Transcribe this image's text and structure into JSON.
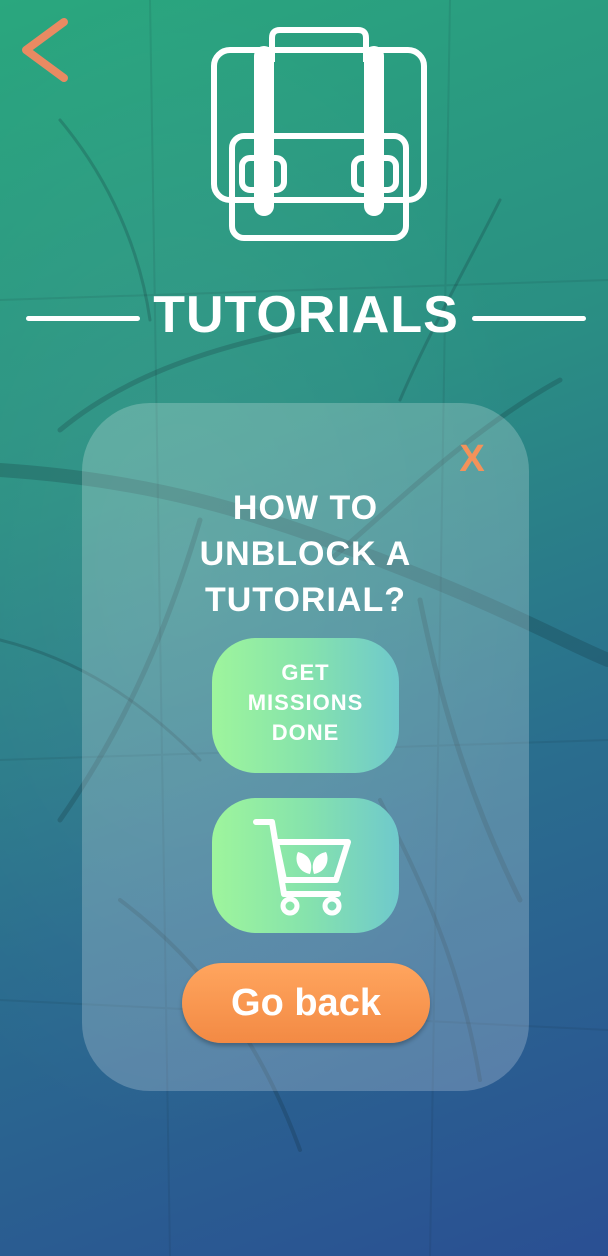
{
  "header": {
    "back_icon": "chevron-left-icon",
    "hero_icon": "briefcase-icon",
    "title": "TUTORIALS"
  },
  "modal": {
    "close_label": "X",
    "heading": "HOW TO\nUNBLOCK A\nTUTORIAL?",
    "missions_button_label": "GET\nMISSIONS\nDONE",
    "shop_button_icon": "shopping-cart-leaf-icon",
    "go_back_label": "Go back"
  },
  "colors": {
    "accent_orange": "#f3925a",
    "button_gradient_start": "#9ef59c",
    "button_gradient_end": "#6fc9cc",
    "background_start": "#2aa77e",
    "background_end": "#2a4f93"
  }
}
